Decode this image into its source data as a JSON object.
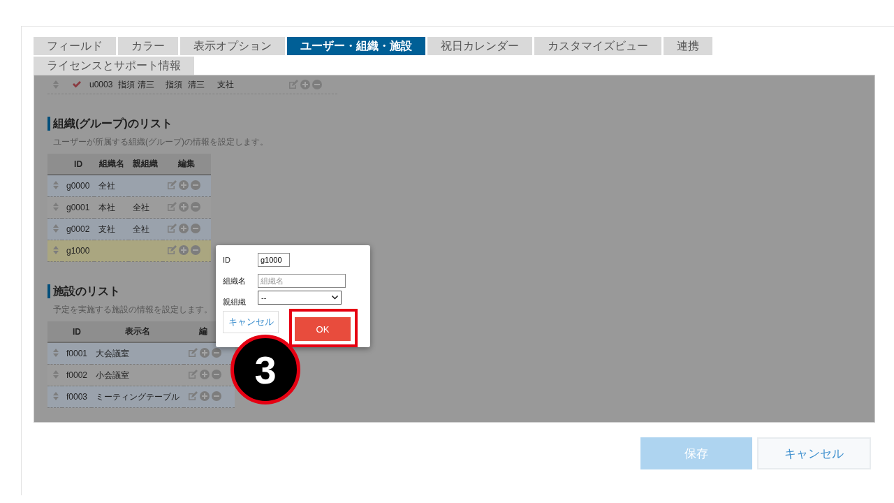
{
  "tabs": [
    {
      "label": "フィールド",
      "selected": false
    },
    {
      "label": "カラー",
      "selected": false
    },
    {
      "label": "表示オプション",
      "selected": false
    },
    {
      "label": "ユーザー・組織・施設",
      "selected": true
    },
    {
      "label": "祝日カレンダー",
      "selected": false
    },
    {
      "label": "カスタマイズビュー",
      "selected": false
    },
    {
      "label": "連携",
      "selected": false
    },
    {
      "label": "ライセンスとサポート情報",
      "selected": false
    }
  ],
  "user_row": {
    "checked": true,
    "cells": [
      "u0003",
      "指須 清三",
      "指須",
      "清三",
      "支社"
    ]
  },
  "organizations": {
    "title": "組織(グループ)のリスト",
    "description": "ユーザーが所属する組織(グループ)の情報を設定します。",
    "columns": [
      "ID",
      "組織名",
      "親組織",
      "編集"
    ],
    "rows": [
      {
        "cells": [
          "g0000",
          "全社",
          ""
        ],
        "selected": false
      },
      {
        "cells": [
          "g0001",
          "本社",
          "全社"
        ],
        "selected": false
      },
      {
        "cells": [
          "g0002",
          "支社",
          "全社"
        ],
        "selected": false
      },
      {
        "cells": [
          "g1000",
          "",
          ""
        ],
        "selected": true
      }
    ]
  },
  "facilities": {
    "title": "施設のリスト",
    "description": "予定を実施する施設の情報を設定します。",
    "columns": [
      "ID",
      "表示名",
      "編"
    ],
    "rows": [
      {
        "cells": [
          "f0001",
          "大会議室"
        ]
      },
      {
        "cells": [
          "f0002",
          "小会議室"
        ]
      },
      {
        "cells": [
          "f0003",
          "ミーティングテーブル"
        ]
      }
    ]
  },
  "dialog": {
    "fields": [
      {
        "label": "ID",
        "kind": "text",
        "value": "g1000"
      },
      {
        "label": "組織名",
        "kind": "text",
        "placeholder": "組織名"
      },
      {
        "label": "親組織",
        "kind": "select",
        "value": "--"
      }
    ],
    "cancel": "キャンセル",
    "ok": "OK"
  },
  "step_badge": "3",
  "footer": {
    "save": "保存",
    "cancel": "キャンセル",
    "save_disabled": true
  }
}
